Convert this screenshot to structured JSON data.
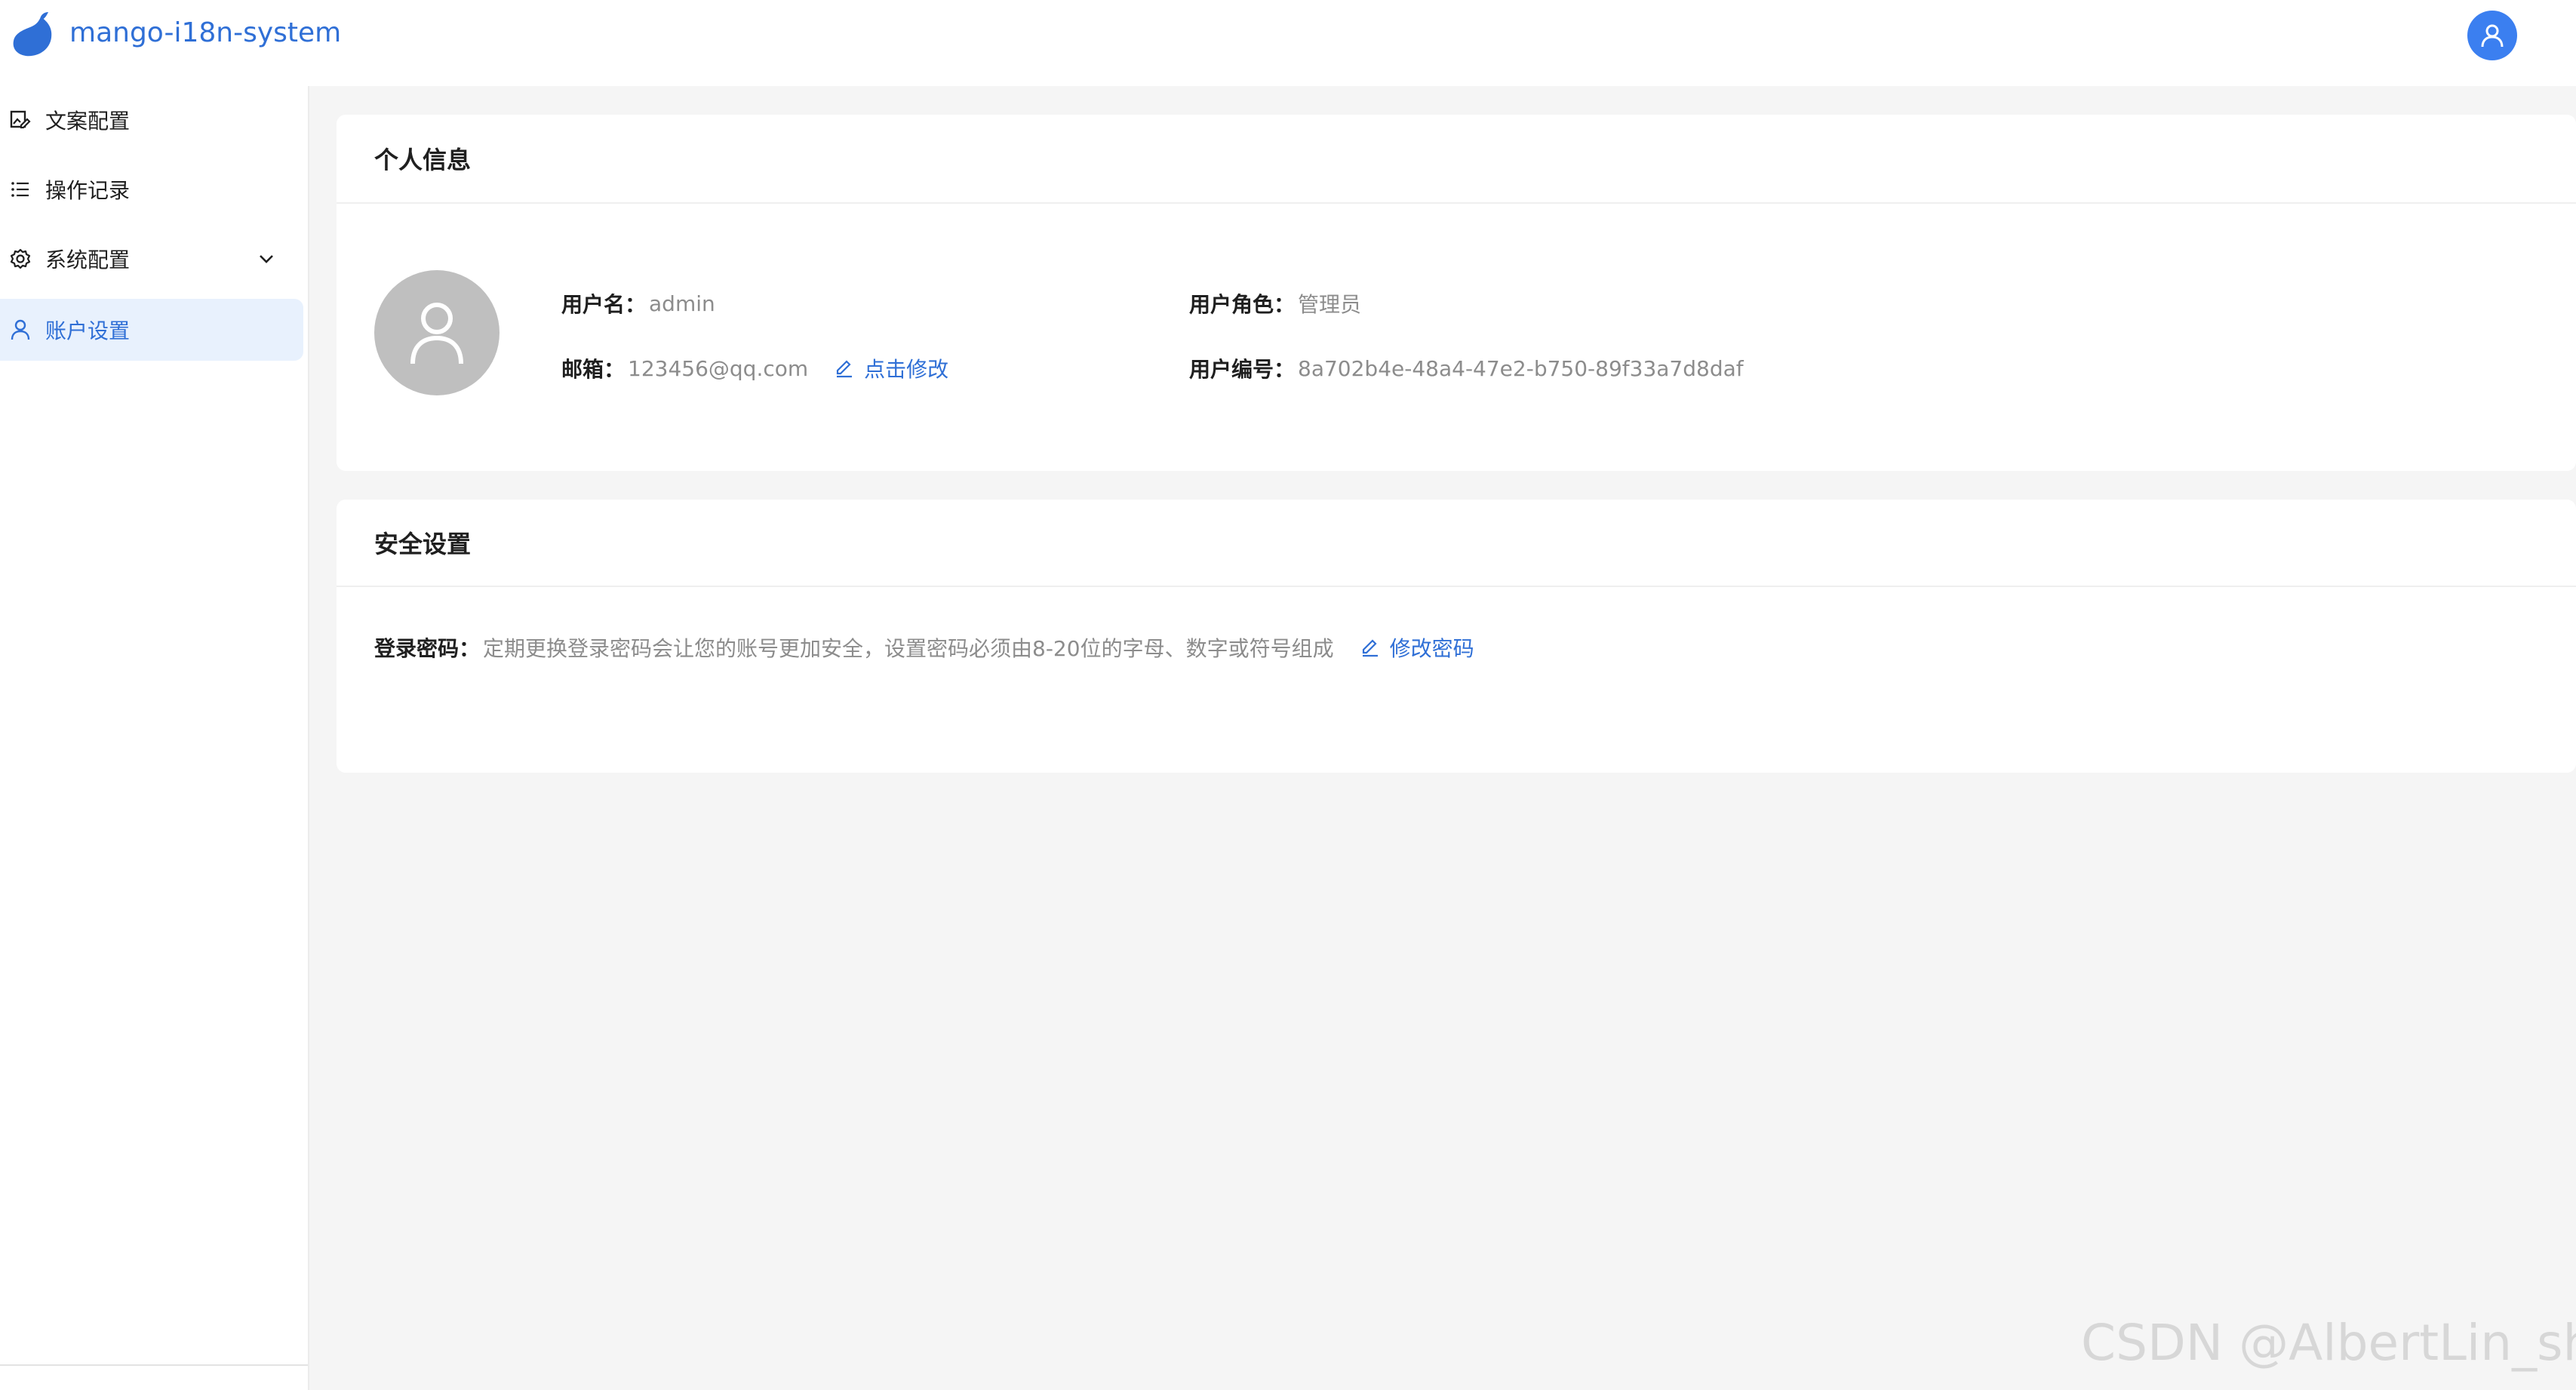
{
  "header": {
    "app_title": "mango-i18n-system",
    "logo_icon": "mango-logo-icon",
    "avatar_icon": "user-icon",
    "accent_color": "#2f6fd6"
  },
  "sidebar": {
    "items": [
      {
        "label": "文案配置",
        "icon": "image-edit-icon",
        "active": false
      },
      {
        "label": "操作记录",
        "icon": "list-icon",
        "active": false
      },
      {
        "label": "系统配置",
        "icon": "gear-icon",
        "active": false,
        "expandable": true
      },
      {
        "label": "账户设置",
        "icon": "user-icon",
        "active": true
      }
    ]
  },
  "profile_card": {
    "title": "个人信息",
    "username_label": "用户名：",
    "username_value": "admin",
    "email_label": "邮箱：",
    "email_value": "123456@qq.com",
    "edit_link": "点击修改",
    "role_label": "用户角色：",
    "role_value": "管理员",
    "id_label": "用户编号：",
    "id_value": "8a702b4e-48a4-47e2-b750-89f33a7d8daf"
  },
  "security_card": {
    "title": "安全设置",
    "password_label": "登录密码：",
    "password_desc": "定期更换登录密码会让您的账号更加安全，设置密码必须由8-20位的字母、数字或符号组成",
    "change_link": "修改密码"
  },
  "watermark": "CSDN @AlbertLin_shu"
}
